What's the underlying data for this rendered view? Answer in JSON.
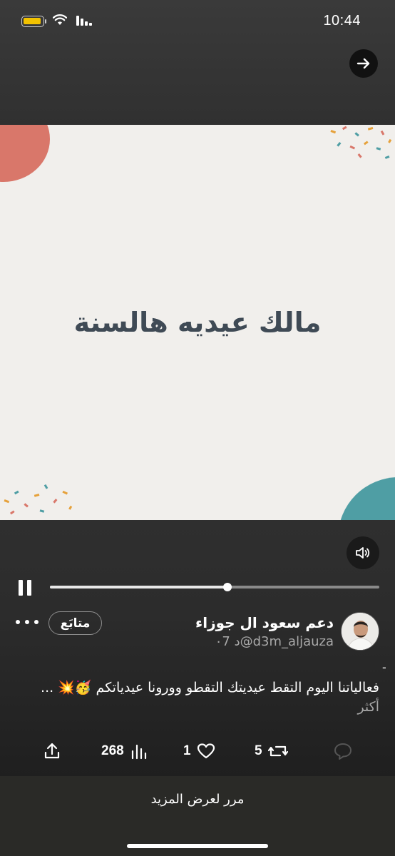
{
  "status_bar": {
    "time": "10:44"
  },
  "video": {
    "caption": "مالك عيديه هالسنة",
    "progress": 0.54
  },
  "post": {
    "author_name": "دعم سعود ال جوزاء",
    "author_handle": "@d3m_aljauza",
    "time_ago": "٠7 د",
    "follow_label": "متابَع",
    "leading_dash": "-",
    "text": "فعالياتنا اليوم التقط عيديتك التقطو وورونا عيدياتكم 🥳💥 ...",
    "more_label": "أكثر"
  },
  "actions": {
    "views": "268",
    "likes": "1",
    "reposts": "5"
  },
  "footer": {
    "swipe_hint": "مرر لعرض المزيد"
  },
  "icons": [
    "battery-icon",
    "wifi-icon",
    "signal-icon",
    "arrow-right-icon",
    "speaker-icon",
    "pause-icon",
    "more-icon",
    "share-icon",
    "views-icon",
    "heart-icon",
    "repost-icon",
    "reply-icon"
  ]
}
